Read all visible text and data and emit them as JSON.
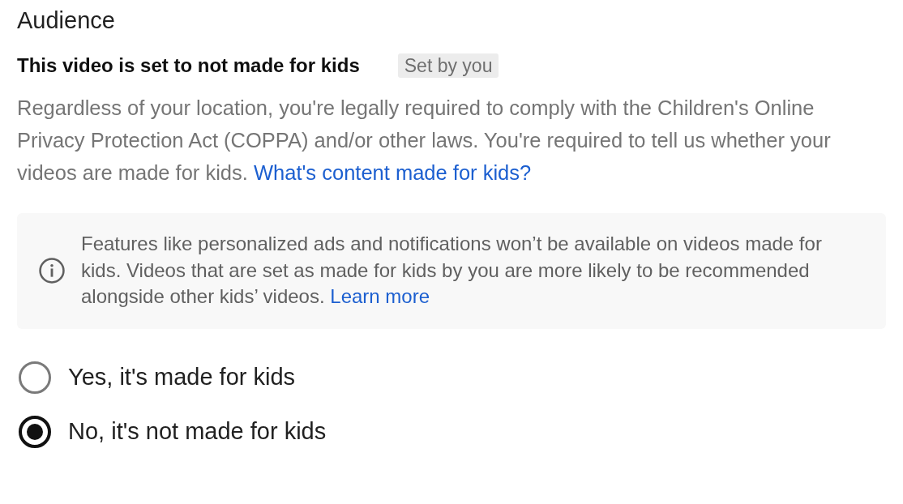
{
  "section": {
    "title": "Audience"
  },
  "status": {
    "label": "This video is set to not made for kids",
    "tag": "Set by you"
  },
  "description": {
    "text": "Regardless of your location, you're legally required to comply with the Children's Online Privacy Protection Act (COPPA) and/or other laws. You're required to tell us whether your videos are made for kids.",
    "link": "What's content made for kids?"
  },
  "notice": {
    "text": "Features like personalized ads and notifications won’t be available on videos made for kids. Videos that are set as made for kids by you are more likely to be recommended alongside other kids’ videos.",
    "link": "Learn more"
  },
  "options": [
    {
      "label": "Yes, it's made for kids",
      "selected": false
    },
    {
      "label": "No, it's not made for kids",
      "selected": true
    }
  ]
}
